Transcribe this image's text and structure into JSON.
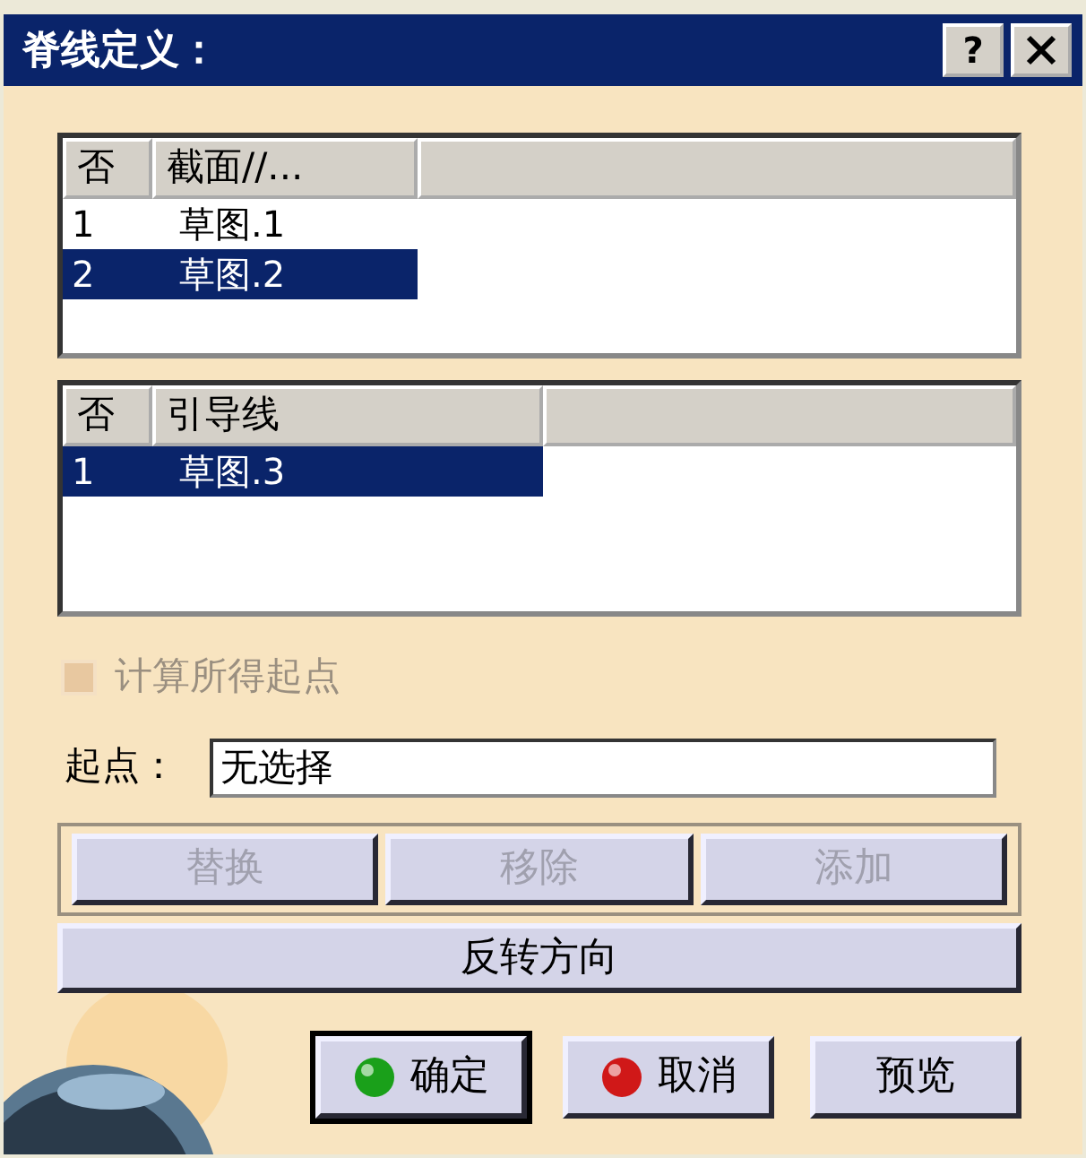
{
  "window": {
    "title": "脊线定义：",
    "help_button": "?"
  },
  "lists": [
    {
      "columns": [
        "否",
        "截面//..."
      ],
      "rows": [
        {
          "cells": [
            "1",
            "草图.1"
          ],
          "selected": false
        },
        {
          "cells": [
            "2",
            "草图.2"
          ],
          "selected": true
        }
      ]
    },
    {
      "columns": [
        "否",
        "引导线"
      ],
      "rows": [
        {
          "cells": [
            "1",
            "草图.3"
          ],
          "selected": true
        }
      ]
    }
  ],
  "option": {
    "label": "计算所得起点",
    "checked": false,
    "disabled": true
  },
  "start_point": {
    "label": "起点：",
    "value": "无选择"
  },
  "edit_buttons": [
    {
      "label": "替换",
      "disabled": true
    },
    {
      "label": "移除",
      "disabled": true
    },
    {
      "label": "添加",
      "disabled": true
    }
  ],
  "reverse_button": {
    "label": "反转方向"
  },
  "dialog_buttons": [
    {
      "label": "确定",
      "kind": "ok",
      "focused": true
    },
    {
      "label": "取消",
      "kind": "cancel",
      "focused": false
    },
    {
      "label": "预览",
      "kind": "preview",
      "focused": false
    }
  ]
}
